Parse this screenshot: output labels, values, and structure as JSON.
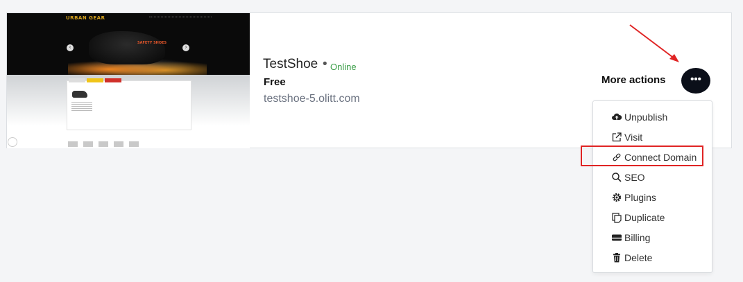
{
  "thumbnail": {
    "logo_text": "URBAN GEAR",
    "hero_text": "SAFETY SHOES"
  },
  "site": {
    "title": "TestShoe",
    "separator": "•",
    "status": "Online",
    "plan": "Free",
    "domain": "testshoe-5.olitt.com"
  },
  "actions": {
    "more_label": "More actions",
    "more_button": "•••"
  },
  "menu": {
    "items": [
      {
        "label": "Unpublish",
        "icon": "cloud-upload-icon"
      },
      {
        "label": "Visit",
        "icon": "external-link-icon"
      },
      {
        "label": "Connect Domain",
        "icon": "link-icon"
      },
      {
        "label": "SEO",
        "icon": "search-icon"
      },
      {
        "label": "Plugins",
        "icon": "gear-icon"
      },
      {
        "label": "Duplicate",
        "icon": "duplicate-icon"
      },
      {
        "label": "Billing",
        "icon": "credit-card-icon"
      },
      {
        "label": "Delete",
        "icon": "trash-icon"
      }
    ]
  },
  "colors": {
    "status_online": "#3a9e47",
    "button_dark": "#0b0f19",
    "annotation_red": "#e02424"
  }
}
